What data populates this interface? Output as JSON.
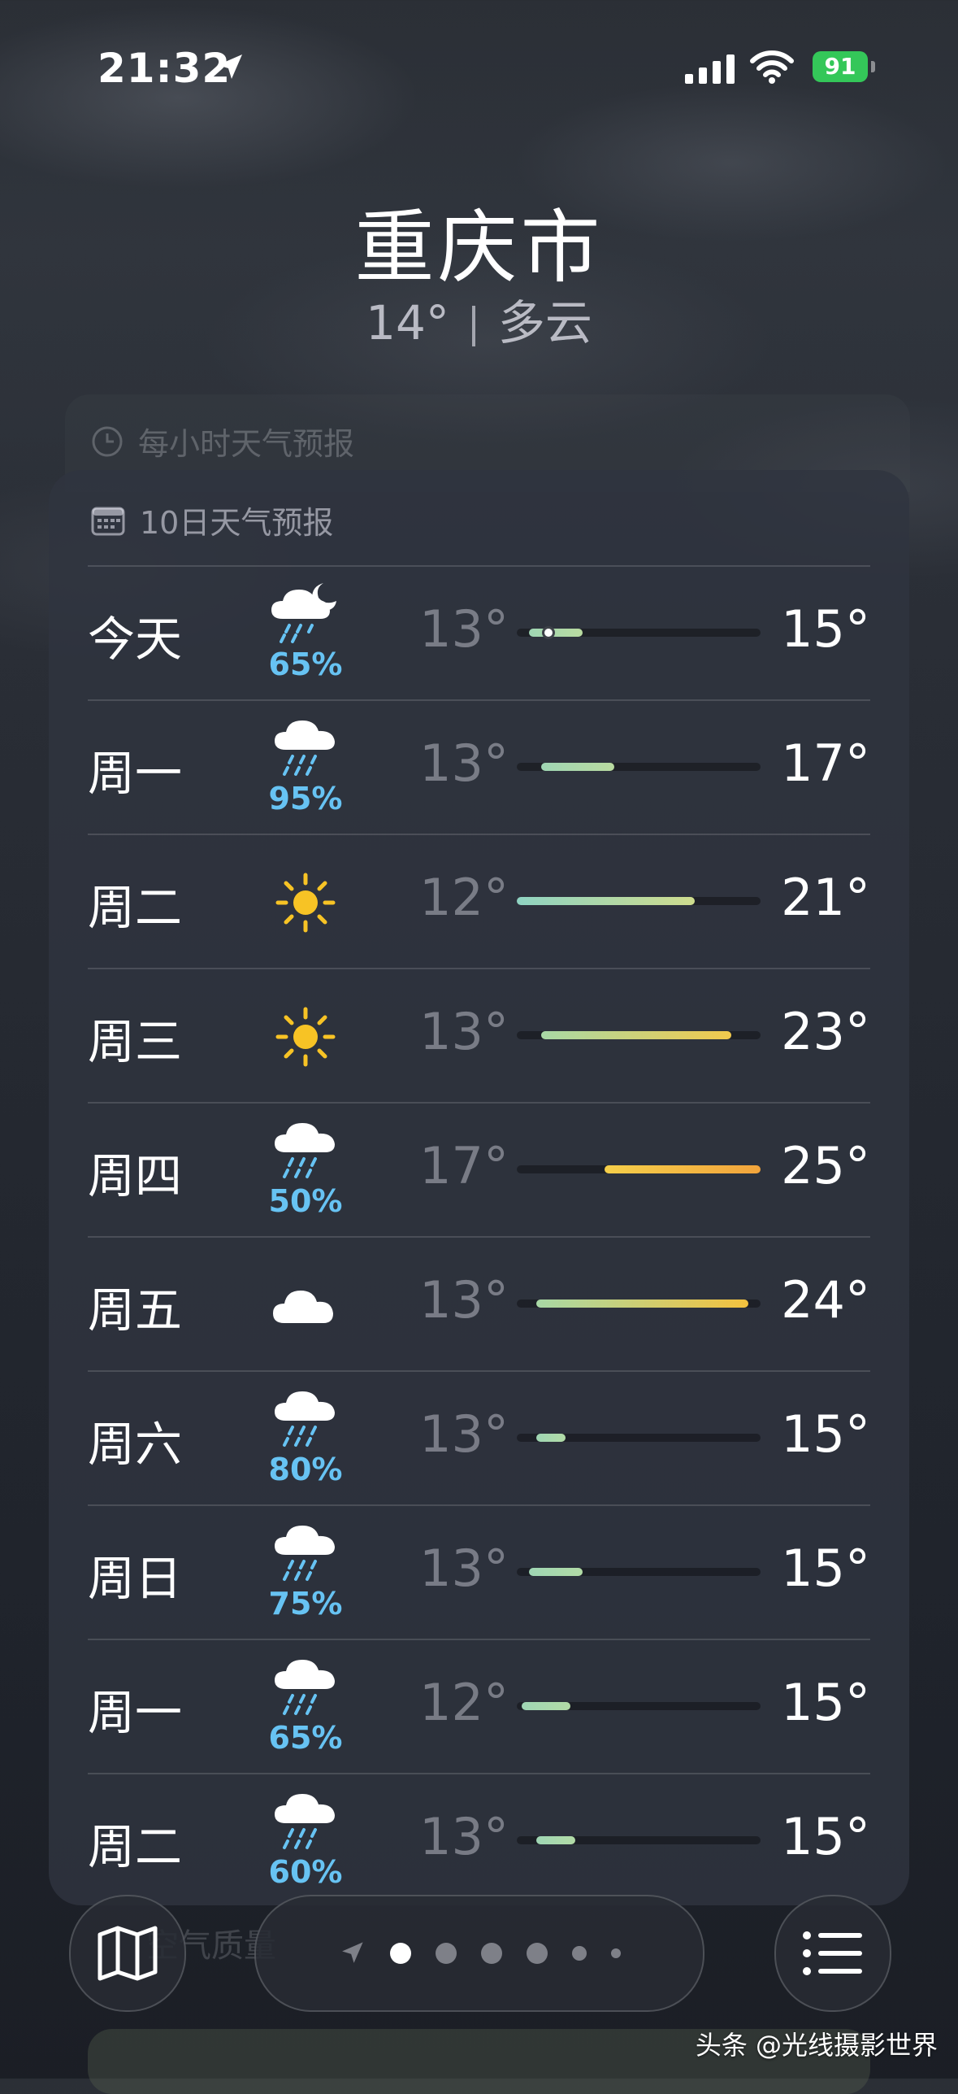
{
  "status_bar": {
    "time": "21:32",
    "battery": "91"
  },
  "header": {
    "city": "重庆市",
    "current_temp": "14°",
    "condition": "多云"
  },
  "hourly": {
    "title": "每小时天气预报"
  },
  "forecast": {
    "title": "10日天气预报",
    "days": [
      {
        "day": "今天",
        "icon": "cloud-moon-rain-icon",
        "precip": "65%",
        "low": "13°",
        "high": "15°",
        "bar_start": 0.05,
        "bar_end": 0.27,
        "current_pos": 0.13,
        "colors": [
          "#9fd6b4",
          "#b9dba0"
        ]
      },
      {
        "day": "周一",
        "icon": "cloud-rain-icon",
        "precip": "95%",
        "low": "13°",
        "high": "17°",
        "bar_start": 0.1,
        "bar_end": 0.4,
        "colors": [
          "#9fd6b4",
          "#b9dba0"
        ]
      },
      {
        "day": "周二",
        "icon": "sun-icon",
        "precip": "",
        "low": "12°",
        "high": "21°",
        "bar_start": 0.0,
        "bar_end": 0.73,
        "colors": [
          "#8fd3c2",
          "#cfdc8e"
        ]
      },
      {
        "day": "周三",
        "icon": "sun-icon",
        "precip": "",
        "low": "13°",
        "high": "23°",
        "bar_start": 0.1,
        "bar_end": 0.88,
        "colors": [
          "#a8d9a6",
          "#f2c94c"
        ]
      },
      {
        "day": "周四",
        "icon": "cloud-rain-icon",
        "precip": "50%",
        "low": "17°",
        "high": "25°",
        "bar_start": 0.36,
        "bar_end": 1.0,
        "colors": [
          "#f5cf4a",
          "#f2a43c"
        ]
      },
      {
        "day": "周五",
        "icon": "cloud-icon",
        "precip": "",
        "low": "13°",
        "high": "24°",
        "bar_start": 0.08,
        "bar_end": 0.95,
        "colors": [
          "#a8d9a6",
          "#f4c23e"
        ]
      },
      {
        "day": "周六",
        "icon": "cloud-rain-icon",
        "precip": "80%",
        "low": "13°",
        "high": "15°",
        "bar_start": 0.08,
        "bar_end": 0.2,
        "colors": [
          "#9fd6b4",
          "#b2dba6"
        ]
      },
      {
        "day": "周日",
        "icon": "cloud-rain-icon",
        "precip": "75%",
        "low": "13°",
        "high": "15°",
        "bar_start": 0.05,
        "bar_end": 0.27,
        "colors": [
          "#9fd6b4",
          "#b2dba6"
        ]
      },
      {
        "day": "周一",
        "icon": "cloud-rain-icon",
        "precip": "65%",
        "low": "12°",
        "high": "15°",
        "bar_start": 0.02,
        "bar_end": 0.22,
        "colors": [
          "#9fd6b4",
          "#b2dba6"
        ]
      },
      {
        "day": "周二",
        "icon": "cloud-rain-icon",
        "precip": "60%",
        "low": "13°",
        "high": "15°",
        "bar_start": 0.08,
        "bar_end": 0.24,
        "colors": [
          "#9fd6b4",
          "#b2dba6"
        ]
      }
    ]
  },
  "air_quality": {
    "title": "空气质量"
  },
  "toolbar": {
    "map": "map-icon",
    "list": "list-icon",
    "page_count": 7,
    "active_page": 1
  },
  "watermark": "头条 @光线摄影世界"
}
